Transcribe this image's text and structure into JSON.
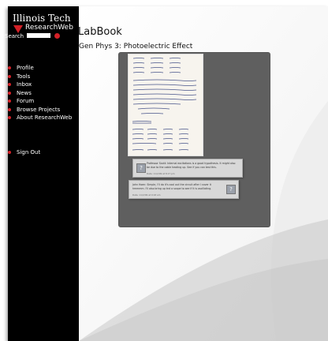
{
  "brand": {
    "line1": "Illinois Tech",
    "line2": "ResearchWeb"
  },
  "search": {
    "label": "Search",
    "value": ""
  },
  "nav": {
    "items": [
      {
        "label": "Profile"
      },
      {
        "label": "Tools"
      },
      {
        "label": "Inbox"
      },
      {
        "label": "News"
      },
      {
        "label": "Forum"
      },
      {
        "label": "Browse Projects"
      },
      {
        "label": "About ResearchWeb"
      }
    ],
    "signout": "Sign Out"
  },
  "header": {
    "title": "LabBook",
    "subtitle": "Gen Phys 3: Photoelectric Effect"
  },
  "comments": [
    {
      "text": "Professor Scott: Internal excitations is a good hypothesis. It might also be due to the cable heating up. See if you can test this.",
      "date": "Date: 11/2/09 at 8:17 pm"
    },
    {
      "text": "John Hoen: Simple, I'll do it's cool out the circuit after I cover it hmmmm. I'll also bring up tnd a scope to see if it is oscillating.",
      "date": "Date: 11/2/09 at 9:18 am"
    }
  ],
  "colors": {
    "accent": "#d42027",
    "sidebar": "#000000",
    "panel": "#5f5f5f"
  }
}
